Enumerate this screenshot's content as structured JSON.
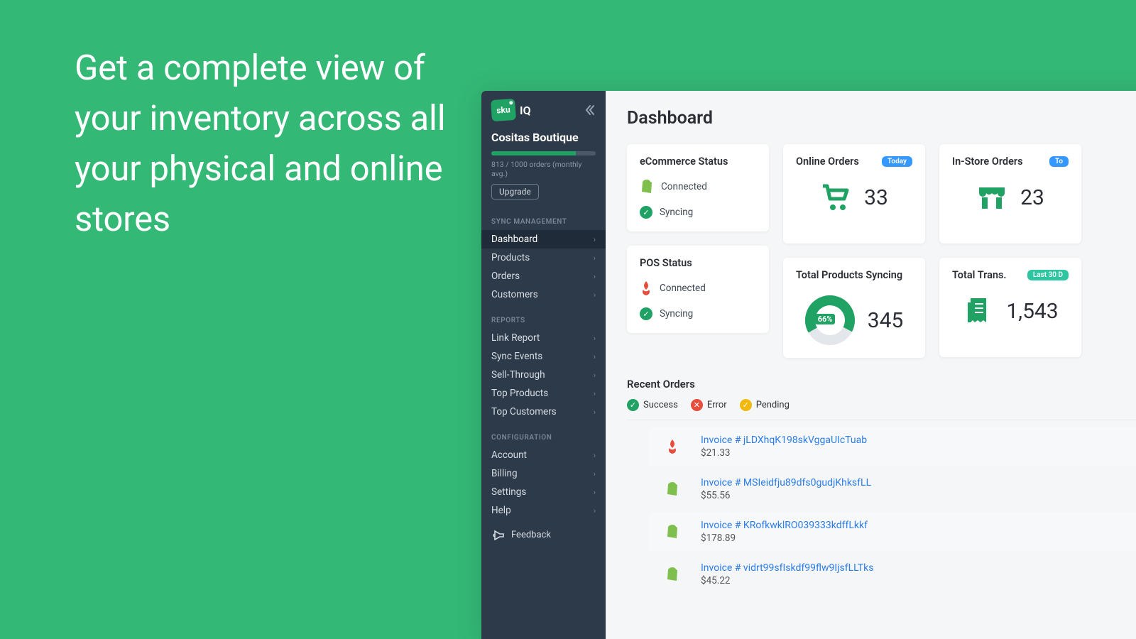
{
  "hero_text": "Get a complete view of your inventory across all your physical and online stores",
  "brand": {
    "logo_text": "sku",
    "logo_suffix": "IQ"
  },
  "store": {
    "name": "Cositas Boutique",
    "usage_text": "813 / 1000 orders (monthly avg.)",
    "usage_pct": 81,
    "upgrade_label": "Upgrade"
  },
  "sections": {
    "sync": "SYNC MANAGEMENT",
    "reports": "REPORTS",
    "config": "CONFIGURATION"
  },
  "nav": {
    "sync": [
      "Dashboard",
      "Products",
      "Orders",
      "Customers"
    ],
    "reports": [
      "Link Report",
      "Sync Events",
      "Sell-Through",
      "Top Products",
      "Top Customers"
    ],
    "config": [
      "Account",
      "Billing",
      "Settings",
      "Help"
    ]
  },
  "feedback_label": "Feedback",
  "page_title": "Dashboard",
  "cards": {
    "ecom": {
      "title": "eCommerce Status",
      "line1": "Connected",
      "line2": "Syncing"
    },
    "pos": {
      "title": "POS Status",
      "line1": "Connected",
      "line2": "Syncing"
    },
    "online_orders": {
      "title": "Online Orders",
      "pill": "Today",
      "value": "33"
    },
    "instore_orders": {
      "title": "In-Store Orders",
      "pill": "To",
      "value": "23"
    },
    "products_syncing": {
      "title": "Total Products Syncing",
      "pct_label": "66%",
      "value": "345"
    },
    "total_trans": {
      "title": "Total Trans.",
      "pill": "Last 30 D",
      "value": "1,543"
    }
  },
  "recent": {
    "title": "Recent Orders",
    "legend": {
      "success": "Success",
      "error": "Error",
      "pending": "Pending"
    },
    "rows": [
      {
        "src": "lightspeed",
        "invoice": "Invoice # jLDXhqK198skVggaUIcTuab",
        "amount": "$21.33"
      },
      {
        "src": "shopify",
        "invoice": "Invoice # MSIeidfju89dfs0gudjKhksfLL",
        "amount": "$55.56"
      },
      {
        "src": "shopify",
        "invoice": "Invoice # KRofkwklRO039333kdffLkkf",
        "amount": "$178.89"
      },
      {
        "src": "shopify",
        "invoice": "Invoice # vidrt99sfIskdf99flw9IjsfLLTks",
        "amount": "$45.22"
      }
    ]
  }
}
